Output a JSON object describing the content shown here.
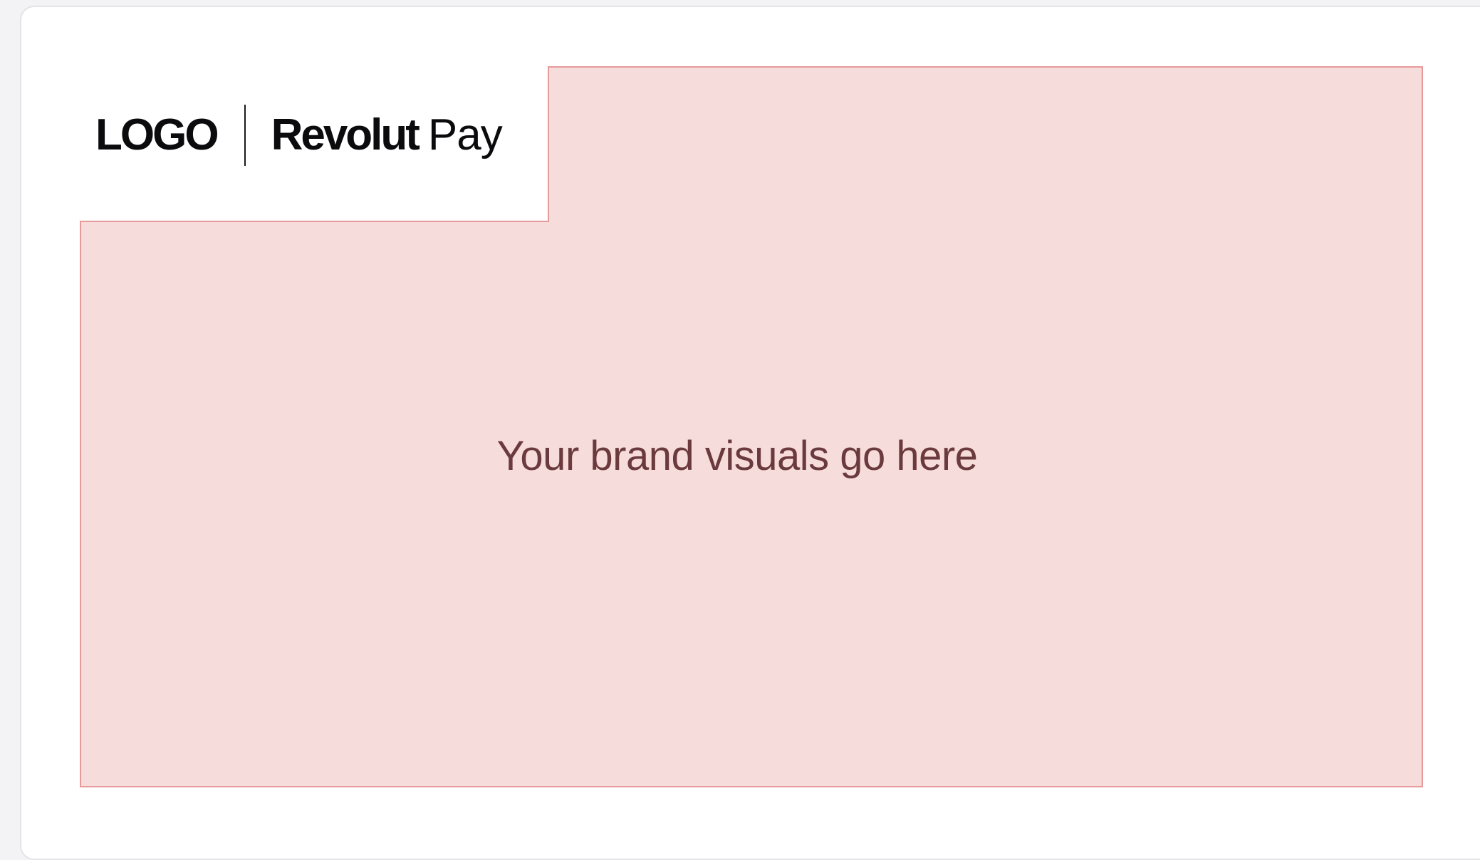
{
  "header": {
    "logo_text": "LOGO",
    "revolut_text": "Revolut",
    "pay_text": "Pay"
  },
  "placeholder": {
    "text": "Your brand visuals go here",
    "fill_color": "#f7dcdc",
    "border_color": "#e79a9a",
    "text_color": "#6a3a3e"
  },
  "colors": {
    "page_background": "#f3f3f6",
    "card_background": "#ffffff",
    "logo_color": "#0b0b0d"
  }
}
